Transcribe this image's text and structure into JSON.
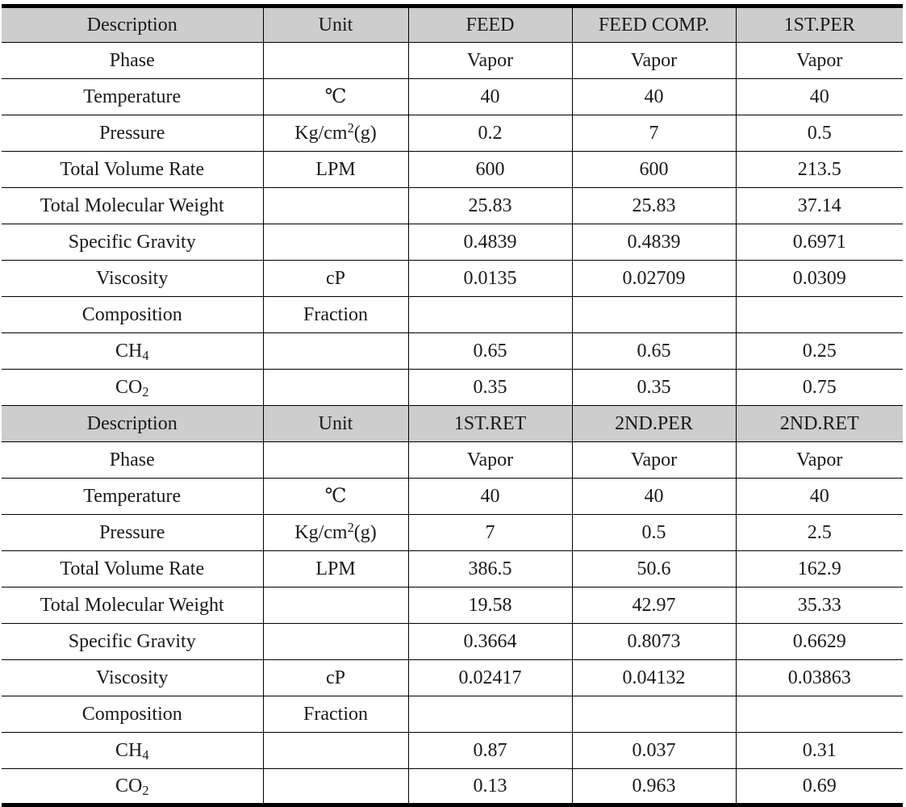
{
  "document": {
    "type": "stream-properties-table",
    "colors": {
      "header_background": "#cdcdcd",
      "border": "#000000",
      "text": "#1a1a1a",
      "page_background": "#ffffff"
    }
  },
  "table": {
    "blocks": [
      {
        "header": {
          "description": "Description",
          "unit": "Unit",
          "streams": [
            "FEED",
            "FEED COMP.",
            "1ST.PER"
          ]
        },
        "rows": [
          {
            "description": "Phase",
            "unit": "",
            "values": [
              "Vapor",
              "Vapor",
              "Vapor"
            ]
          },
          {
            "description": "Temperature",
            "unit": "℃",
            "values": [
              "40",
              "40",
              "40"
            ]
          },
          {
            "description": "Pressure",
            "unit": "Kg/cm2(g)",
            "unit_html": "Kg/cm<sup>2</sup>(g)",
            "values": [
              "0.2",
              "7",
              "0.5"
            ]
          },
          {
            "description": "Total Volume Rate",
            "unit": "LPM",
            "values": [
              "600",
              "600",
              "213.5"
            ]
          },
          {
            "description": "Total Molecular Weight",
            "unit": "",
            "values": [
              "25.83",
              "25.83",
              "37.14"
            ]
          },
          {
            "description": "Specific Gravity",
            "unit": "",
            "values": [
              "0.4839",
              "0.4839",
              "0.6971"
            ]
          },
          {
            "description": "Viscosity",
            "unit": "cP",
            "values": [
              "0.0135",
              "0.02709",
              "0.0309"
            ]
          },
          {
            "description": "Composition",
            "unit": "Fraction",
            "values": [
              "",
              "",
              ""
            ]
          },
          {
            "description": "CH4",
            "description_html": "CH<sub>4</sub>",
            "unit": "",
            "values": [
              "0.65",
              "0.65",
              "0.25"
            ]
          },
          {
            "description": "CO2",
            "description_html": "CO<sub>2</sub>",
            "unit": "",
            "values": [
              "0.35",
              "0.35",
              "0.75"
            ]
          }
        ]
      },
      {
        "header": {
          "description": "Description",
          "unit": "Unit",
          "streams": [
            "1ST.RET",
            "2ND.PER",
            "2ND.RET"
          ]
        },
        "rows": [
          {
            "description": "Phase",
            "unit": "",
            "values": [
              "Vapor",
              "Vapor",
              "Vapor"
            ]
          },
          {
            "description": "Temperature",
            "unit": "℃",
            "values": [
              "40",
              "40",
              "40"
            ]
          },
          {
            "description": "Pressure",
            "unit": "Kg/cm2(g)",
            "unit_html": "Kg/cm<sup>2</sup>(g)",
            "values": [
              "7",
              "0.5",
              "2.5"
            ]
          },
          {
            "description": "Total Volume Rate",
            "unit": "LPM",
            "values": [
              "386.5",
              "50.6",
              "162.9"
            ]
          },
          {
            "description": "Total Molecular Weight",
            "unit": "",
            "values": [
              "19.58",
              "42.97",
              "35.33"
            ]
          },
          {
            "description": "Specific Gravity",
            "unit": "",
            "values": [
              "0.3664",
              "0.8073",
              "0.6629"
            ]
          },
          {
            "description": "Viscosity",
            "unit": "cP",
            "values": [
              "0.02417",
              "0.04132",
              "0.03863"
            ]
          },
          {
            "description": "Composition",
            "unit": "Fraction",
            "values": [
              "",
              "",
              ""
            ]
          },
          {
            "description": "CH4",
            "description_html": "CH<sub>4</sub>",
            "unit": "",
            "values": [
              "0.87",
              "0.037",
              "0.31"
            ]
          },
          {
            "description": "CO2",
            "description_html": "CO<sub>2</sub>",
            "unit": "",
            "values": [
              "0.13",
              "0.963",
              "0.69"
            ]
          }
        ]
      }
    ]
  }
}
